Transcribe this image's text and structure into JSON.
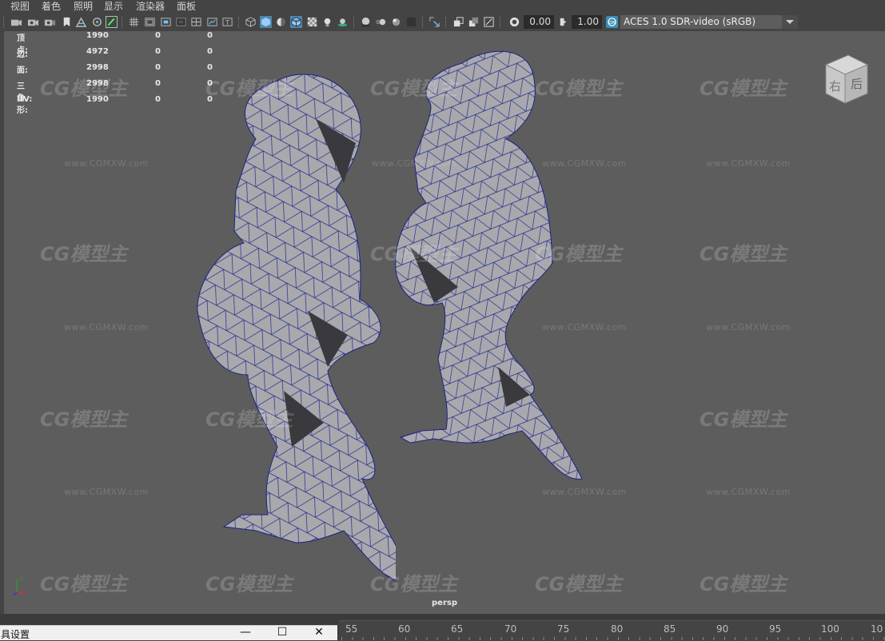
{
  "menu": [
    "视图",
    "着色",
    "照明",
    "显示",
    "渲染器",
    "面板"
  ],
  "toolbar": {
    "exposure_value": "0.00",
    "gamma_value": "1.00",
    "color_space": "ACES 1.0 SDR-video (sRGB)",
    "icons": [
      "camera-icon",
      "camera-attributes-icon",
      "bookmark-icon",
      "image-plane-icon",
      "select-camera-icon",
      "grease-pencil-icon",
      "grid-icon",
      "film-gate-icon",
      "resolution-gate-icon",
      "gate-mask-icon",
      "field-chart-icon",
      "safe-action-icon",
      "safe-title-icon",
      "wireframe-icon",
      "smooth-shade-icon",
      "default-material-icon",
      "wireframe-on-shaded-icon",
      "textured-icon",
      "use-lights-icon",
      "shadows-icon",
      "screen-space-ao-icon",
      "motion-blur-icon",
      "anti-aliasing-icon",
      "depth-of-field-icon",
      "isolate-select-icon",
      "xray-icon",
      "xray-active-components-icon",
      "xray-joints-icon",
      "exposure-icon",
      "gamma-icon",
      "color-management-icon"
    ]
  },
  "hud": {
    "rows": [
      {
        "label": "顶点:",
        "values": [
          "1990",
          "0",
          "0"
        ]
      },
      {
        "label": "边:",
        "values": [
          "4972",
          "0",
          "0"
        ]
      },
      {
        "label": "面:",
        "values": [
          "2998",
          "0",
          "0"
        ]
      },
      {
        "label": "三角形:",
        "values": [
          "2998",
          "0",
          "0"
        ]
      },
      {
        "label": "UV:",
        "values": [
          "1990",
          "0",
          "0"
        ]
      }
    ]
  },
  "viewcube": {
    "front_text": "右",
    "side_text": "后"
  },
  "watermark": {
    "logo": "CG模型主",
    "url": "www.CGMXW.com"
  },
  "camera_label": "persp",
  "timeline": {
    "ticks": [
      "55",
      "60",
      "65",
      "70",
      "75",
      "80",
      "85",
      "90",
      "95",
      "100",
      "10"
    ]
  },
  "tool_window": {
    "title": "具设置",
    "minimize": "—",
    "maximize": "☐",
    "close": "✕"
  }
}
